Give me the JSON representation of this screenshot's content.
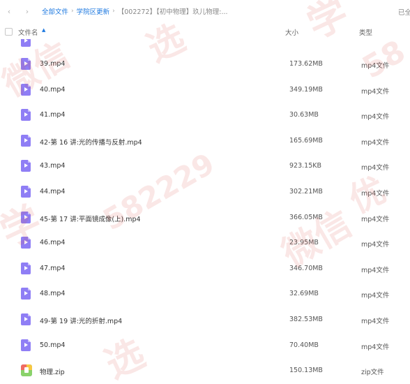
{
  "breadcrumb": {
    "items": [
      "全部文件",
      "学院区更新"
    ],
    "current": "【002272】【初中物理】玖儿物理:..."
  },
  "status_right": "已全",
  "header": {
    "name": "文件名",
    "size": "大小",
    "type": "类型"
  },
  "files": [
    {
      "name": "39.mp4",
      "size": "173.62MB",
      "type": "mp4文件",
      "icon": "video-file-icon"
    },
    {
      "name": "40.mp4",
      "size": "349.19MB",
      "type": "mp4文件",
      "icon": "video-file-icon"
    },
    {
      "name": "41.mp4",
      "size": "30.63MB",
      "type": "mp4文件",
      "icon": "video-file-icon"
    },
    {
      "name": "42-第 16 讲:光的传播与反射.mp4",
      "size": "165.69MB",
      "type": "mp4文件",
      "icon": "video-file-icon"
    },
    {
      "name": "43.mp4",
      "size": "923.15KB",
      "type": "mp4文件",
      "icon": "video-file-icon"
    },
    {
      "name": "44.mp4",
      "size": "302.21MB",
      "type": "mp4文件",
      "icon": "video-file-icon"
    },
    {
      "name": "45-第 17 讲:平面镜成像(上).mp4",
      "size": "366.05MB",
      "type": "mp4文件",
      "icon": "video-file-icon"
    },
    {
      "name": "46.mp4",
      "size": "23.95MB",
      "type": "mp4文件",
      "icon": "video-file-icon"
    },
    {
      "name": "47.mp4",
      "size": "346.70MB",
      "type": "mp4文件",
      "icon": "video-file-icon"
    },
    {
      "name": "48.mp4",
      "size": "32.69MB",
      "type": "mp4文件",
      "icon": "video-file-icon"
    },
    {
      "name": "49-第 19 讲:光的折射.mp4",
      "size": "382.53MB",
      "type": "mp4文件",
      "icon": "video-file-icon"
    },
    {
      "name": "50.mp4",
      "size": "70.40MB",
      "type": "mp4文件",
      "icon": "video-file-icon"
    },
    {
      "name": "物理.zip",
      "size": "150.13MB",
      "type": "zip文件",
      "icon": "zip-file-icon"
    }
  ],
  "watermark": {
    "texts": [
      "学",
      "微信",
      "选",
      "582229",
      "学",
      "微信",
      "58",
      "选",
      "优"
    ],
    "color": "#d6443a"
  },
  "colors": {
    "link": "#1f7ae0",
    "video_icon": "#8f7ef5"
  }
}
